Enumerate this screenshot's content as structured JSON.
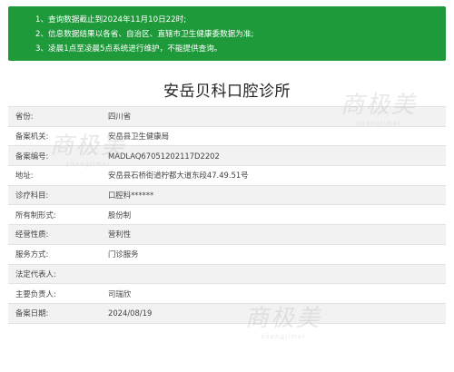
{
  "notice": {
    "items": [
      {
        "num": "1、",
        "text": "查询数据截止到2024年11月10日22时;"
      },
      {
        "num": "2、",
        "text": "信息数据结果以各省、自治区、直辖市卫生健康委数据为准;"
      },
      {
        "num": "3、",
        "text": "凌晨1点至凌晨5点系统进行维护，不能提供查询。"
      }
    ]
  },
  "title": "安岳贝科口腔诊所",
  "table": {
    "rows": [
      {
        "label": "省份:",
        "value": "四川省"
      },
      {
        "label": "备案机关:",
        "value": "安岳县卫生健康局"
      },
      {
        "label": "备案编号:",
        "value": "MADLAQ67051202117D2202"
      },
      {
        "label": "地址:",
        "value": "安岳县石桥街道柠都大道东段47.49.51号"
      },
      {
        "label": "诊疗科目:",
        "value": "口腔科******"
      },
      {
        "label": "所有制形式:",
        "value": "股份制"
      },
      {
        "label": "经营性质:",
        "value": "营利性"
      },
      {
        "label": "服务方式:",
        "value": "门诊服务"
      },
      {
        "label": "法定代表人:",
        "value": ""
      },
      {
        "label": "主要负责人:",
        "value": "司瑞欣"
      },
      {
        "label": "备案日期:",
        "value": "2024/08/19"
      }
    ]
  },
  "watermark": {
    "text": "商极美",
    "sub": "shangjimei"
  }
}
